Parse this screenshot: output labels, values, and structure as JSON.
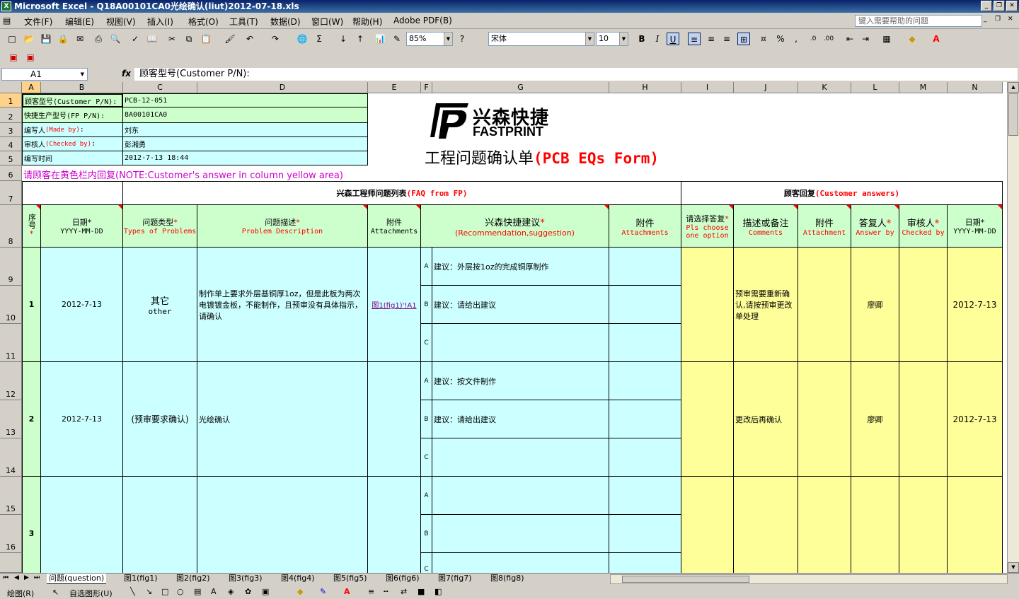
{
  "window": {
    "title": "Microsoft Excel - Q18A00101CA0光绘确认(liut)2012-07-18.xls",
    "app_icon": "excel-icon"
  },
  "menu": [
    "文件(F)",
    "编辑(E)",
    "视图(V)",
    "插入(I)",
    "格式(O)",
    "工具(T)",
    "数据(D)",
    "窗口(W)",
    "帮助(H)",
    "Adobe PDF(B)"
  ],
  "help_placeholder": "键入需要帮助的问题",
  "toolbar": {
    "zoom": "85%",
    "font": "宋体",
    "size": "10"
  },
  "formula": {
    "cell_ref": "A1",
    "fx": "fx",
    "content": "顾客型号(Customer P/N):"
  },
  "columns": [
    "A",
    "B",
    "C",
    "D",
    "E",
    "F",
    "G",
    "H",
    "I",
    "J",
    "K",
    "L",
    "M",
    "N"
  ],
  "rows": [
    "1",
    "2",
    "3",
    "4",
    "5",
    "6",
    "7",
    "8",
    "9",
    "10",
    "11",
    "12",
    "13",
    "14",
    "15",
    "16"
  ],
  "header_info": {
    "r1_label": "顾客型号(Customer P/N):",
    "r1_value": "PCB-12-051",
    "r2_label": "快捷生产型号(FP P/N):",
    "r2_value": "8A00101CA0",
    "r3_label": "编写人",
    "r3_label_en": "(Made by)",
    "r3_colon": ":",
    "r3_value": "刘东",
    "r4_label": "审核人",
    "r4_label_en": "(Checked by)",
    "r4_colon": ":",
    "r4_value": "彭湘勇",
    "r5_label": "编写时间",
    "r5_value": "2012-7-13 18:44"
  },
  "logo": {
    "cn": "兴森快捷",
    "en": "FASTPRINT"
  },
  "form_title": {
    "cn": "工程问题确认单",
    "en": "(PCB EQs Form)"
  },
  "note": "请顾客在黄色栏内回复(NOTE:Customer's answer in column yellow area)",
  "section": {
    "fp_cn": "兴森工程师问题列表",
    "fp_en": "(FAQ from FP)",
    "cust_cn": "顾客回复",
    "cust_en": "(Customer answers)"
  },
  "headers": {
    "seq_cn": "序号",
    "date_cn": "日期",
    "date_fmt": "YYYY-MM-DD",
    "type_cn": "问题类型",
    "type_en": "Types of Problems",
    "desc_cn": "问题描述",
    "desc_en": "Problem Description",
    "att_cn": "附件",
    "att_en": "Attachments",
    "rec_cn": "兴森快捷建议",
    "rec_en": "(Recommendation,suggestion)",
    "att2_cn": "附件",
    "att2_en": "Attachments",
    "choose_cn": "请选择答复",
    "choose_en": "Pls choose one option",
    "comm_cn": "描述或备注",
    "comm_en": "Comments",
    "att3_cn": "附件",
    "att3_en": "Attachment",
    "ans_cn": "答复人",
    "ans_en": "Answer by",
    "chk_cn": "审核人",
    "chk_en": "Checked by",
    "date2_cn": "日期",
    "date2_fmt": "YYYY-MM-DD",
    "star": "*"
  },
  "questions": [
    {
      "no": "1",
      "date": "2012-7-13",
      "type_cn": "其它",
      "type_en": "other",
      "desc": "制作单上要求外层基铜厚1oz，但是此板为两次电镀镀金板，不能制作，且预审没有具体指示，请确认",
      "attach": "图1(fig1)'!A1",
      "options": [
        {
          "k": "A",
          "v": "建议：外层按1oz的完成铜厚制作"
        },
        {
          "k": "B",
          "v": "建议：请给出建议"
        },
        {
          "k": "C",
          "v": ""
        }
      ],
      "comment": "预审需要重新确认,请按预审更改单处理",
      "answer": "廖卿",
      "checked": "",
      "date2": "2012-7-13"
    },
    {
      "no": "2",
      "date": "2012-7-13",
      "type_cn": "(预审要求确认)",
      "type_en": "",
      "desc": "光绘确认",
      "attach": "",
      "options": [
        {
          "k": "A",
          "v": "建议：按文件制作"
        },
        {
          "k": "B",
          "v": "建议：请给出建议"
        },
        {
          "k": "C",
          "v": ""
        }
      ],
      "comment": "更改后再确认",
      "answer": "廖卿",
      "checked": "",
      "date2": "2012-7-13"
    },
    {
      "no": "3",
      "date": "",
      "type_cn": "",
      "type_en": "",
      "desc": "",
      "attach": "",
      "options": [
        {
          "k": "A",
          "v": ""
        },
        {
          "k": "B",
          "v": ""
        },
        {
          "k": "C",
          "v": ""
        }
      ],
      "comment": "",
      "answer": "",
      "checked": "",
      "date2": ""
    }
  ],
  "sheets": [
    "问题(question)",
    "图1(fig1)",
    "图2(fig2)",
    "图3(fig3)",
    "图4(fig4)",
    "图5(fig5)",
    "图6(fig6)",
    "图7(fig7)",
    "图8(fig8)"
  ],
  "drawbar": {
    "draw": "绘图(R)",
    "autoshape": "自选图形(U)"
  }
}
